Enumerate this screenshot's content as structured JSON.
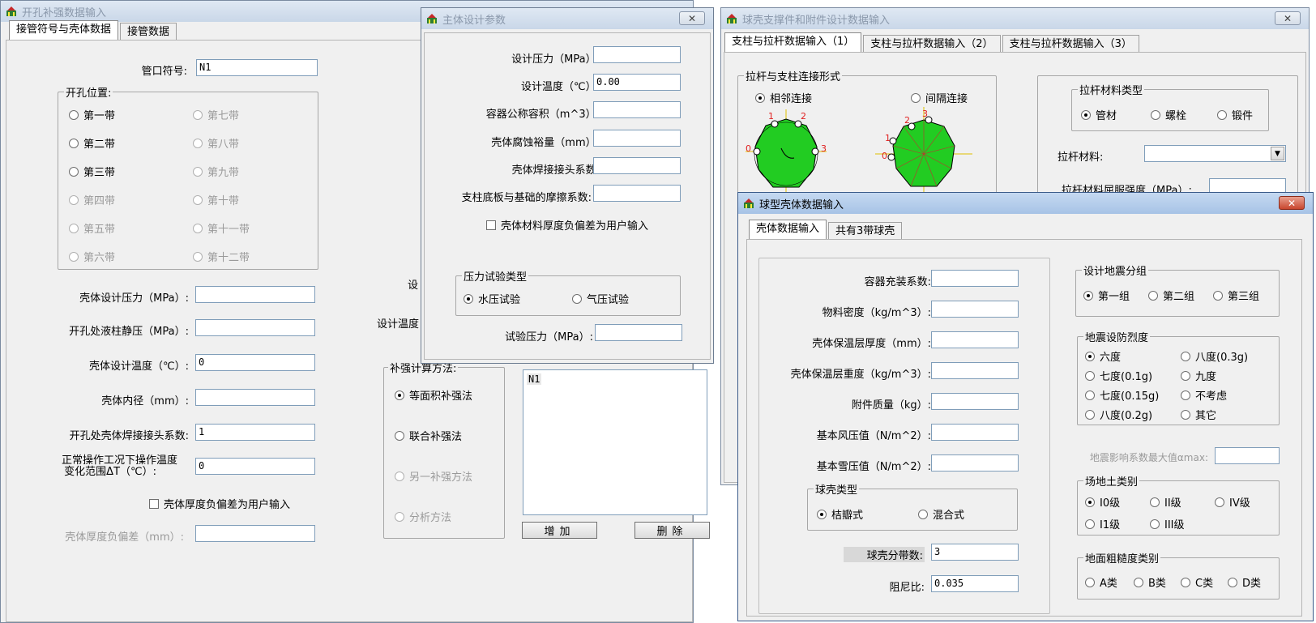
{
  "win1": {
    "title": "开孔补强数据输入",
    "tabs": [
      "接管符号与壳体数据",
      "接管数据"
    ],
    "nozzle_label": "管口符号:",
    "nozzle_value": "N1",
    "position_group": "开孔位置:",
    "bands": [
      "第一带",
      "第七带",
      "第二带",
      "第八带",
      "第三带",
      "第九带",
      "第四带",
      "第十带",
      "第五带",
      "第十一带",
      "第六带",
      "第十二带"
    ],
    "fields": [
      {
        "label": "壳体设计压力（MPa）:",
        "value": ""
      },
      {
        "label": "开孔处液柱静压（MPa）:",
        "value": ""
      },
      {
        "label": "壳体设计温度（℃）:",
        "value": "0"
      },
      {
        "label": "壳体内径（mm）:",
        "value": ""
      },
      {
        "label": "开孔处壳体焊接接头系数:",
        "value": "1"
      }
    ],
    "temp_label_1": "正常操作工况下操作温度",
    "temp_label_2": "变化范围ΔT（℃）:",
    "temp_value": "0",
    "thickness_check": "壳体厚度负偏差为用户输入",
    "thickness_label": "壳体厚度负偏差（mm）:",
    "thickness_value": "",
    "hidden_label_1": "设",
    "hidden_label_2": "设计温度",
    "method_group": "补强计算方法:",
    "methods": [
      "等面积补强法",
      "联合补强法",
      "另一补强方法",
      "分析方法"
    ],
    "list_item": "N1",
    "add_button": "增加",
    "delete_button": "删除"
  },
  "win2": {
    "title": "主体设计参数",
    "fields": [
      {
        "label": "设计压力（MPa）:",
        "value": ""
      },
      {
        "label": "设计温度（℃）:",
        "value": "0.00"
      },
      {
        "label": "容器公称容积（m^3）:",
        "value": ""
      },
      {
        "label": "壳体腐蚀裕量（mm）:",
        "value": ""
      },
      {
        "label": "壳体焊接接头系数:",
        "value": ""
      },
      {
        "label": "支柱底板与基础的摩擦系数:",
        "value": ""
      }
    ],
    "material_check": "壳体材料厚度负偏差为用户输入",
    "test_group": "压力试验类型",
    "test_options": [
      "水压试验",
      "气压试验"
    ],
    "test_pressure_label": "试验压力（MPa）:",
    "test_pressure_value": ""
  },
  "win3": {
    "title": "球壳支撑件和附件设计数据输入",
    "tabs": [
      "支柱与拉杆数据输入（1）",
      "支柱与拉杆数据输入（2）",
      "支柱与拉杆数据输入（3）"
    ],
    "connection_group": "拉杆与支柱连接形式",
    "connection_options": [
      "相邻连接",
      "间隔连接"
    ],
    "material_type_group": "拉杆材料类型",
    "material_types": [
      "管材",
      "螺栓",
      "锻件"
    ],
    "rod_material_label": "拉杆材料:",
    "yield_label": "拉杆材料屈服强度（MPa）:",
    "diagram_labels_a": [
      "1",
      "2",
      "0",
      "3"
    ],
    "diagram_labels_b": [
      "2",
      "3",
      "1",
      "0"
    ]
  },
  "win4": {
    "title": "球型壳体数据输入",
    "tabs": [
      "壳体数据输入",
      "共有3带球壳"
    ],
    "fields": [
      {
        "label": "容器充装系数:",
        "value": ""
      },
      {
        "label": "物料密度（kg/m^3）:",
        "value": ""
      },
      {
        "label": "壳体保温层厚度（mm）:",
        "value": ""
      },
      {
        "label": "壳体保温层重度（kg/m^3）:",
        "value": ""
      },
      {
        "label": "附件质量（kg）:",
        "value": ""
      },
      {
        "label": "基本风压值（N/m^2）:",
        "value": ""
      },
      {
        "label": "基本雪压值（N/m^2）:",
        "value": ""
      }
    ],
    "shell_type_group": "球壳类型",
    "shell_types": [
      "桔瓣式",
      "混合式"
    ],
    "band_count_label": "球壳分带数:",
    "band_count_value": "3",
    "damping_label": "阻尼比:",
    "damping_value": "0.035",
    "seismic_group": "设计地震分组",
    "seismic_groups": [
      "第一组",
      "第二组",
      "第三组"
    ],
    "intensity_group": "地震设防烈度",
    "intensities": [
      "六度",
      "八度(0.3g)",
      "七度(0.1g)",
      "九度",
      "七度(0.15g)",
      "不考虑",
      "八度(0.2g)",
      "其它"
    ],
    "alpha_label": "地震影响系数最大值αmax:",
    "site_group": "场地土类别",
    "site_classes": [
      "I0级",
      "II级",
      "IV级",
      "I1级",
      "III级"
    ],
    "rough_group": "地面粗糙度类别",
    "rough_classes": [
      "A类",
      "B类",
      "C类",
      "D类"
    ]
  }
}
